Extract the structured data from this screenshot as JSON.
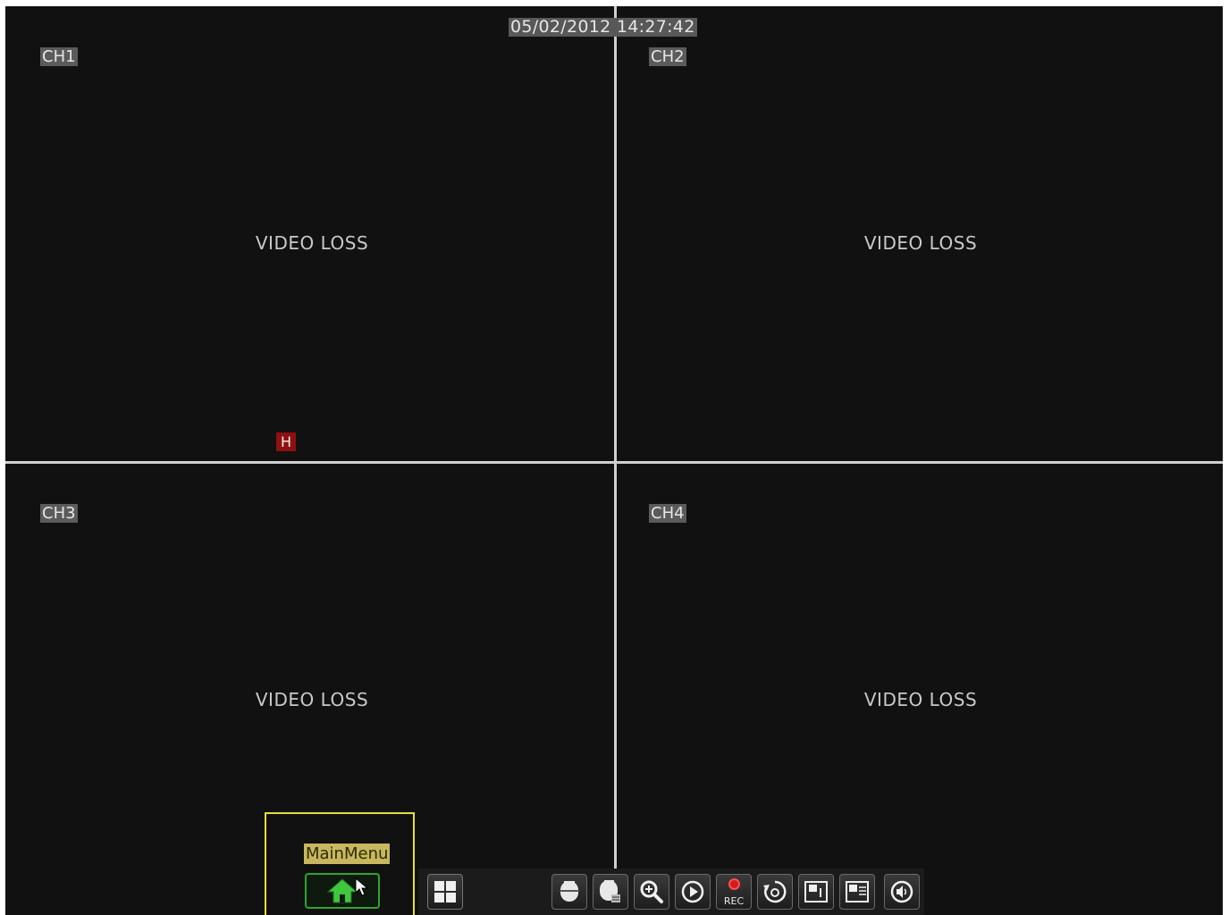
{
  "datetime": "05/02/2012 14:27:42",
  "channels": [
    {
      "label": "CH1",
      "status": "VIDEO LOSS"
    },
    {
      "label": "CH2",
      "status": "VIDEO LOSS"
    },
    {
      "label": "CH3",
      "status": "VIDEO LOSS"
    },
    {
      "label": "CH4",
      "status": "VIDEO LOSS"
    }
  ],
  "ch1_badge": "H",
  "toolbar": {
    "main_menu_label": "MainMenu",
    "rec_label": "REC",
    "icons": [
      "home-icon",
      "quad-view-icon",
      "ptz-camera-icon",
      "ptz-settings-icon",
      "zoom-icon",
      "playback-icon",
      "record-icon",
      "sequence-icon",
      "previous-screen-icon",
      "next-screen-icon",
      "audio-icon"
    ]
  },
  "colors": {
    "background": "#111111",
    "grid": "#cfcfcf",
    "highlight": "#e3df37",
    "home": "#3fc83f",
    "record": "#d51a1a",
    "badge": "#8e1010"
  }
}
